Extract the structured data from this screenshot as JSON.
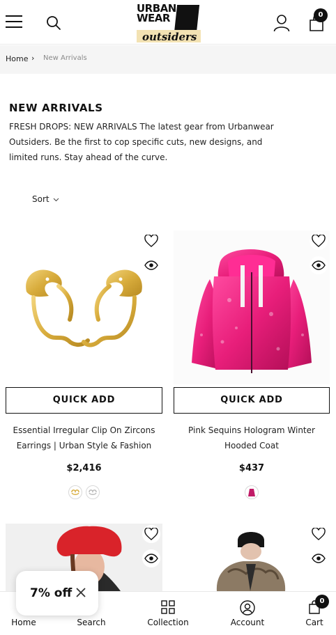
{
  "header": {
    "logo_text_top": "URBAN WEAR",
    "logo_text_bottom": "outsiders",
    "cart_count": "0"
  },
  "breadcrumb": {
    "home": "Home",
    "separator": "›",
    "current": "New Arrivals"
  },
  "collection": {
    "title": "NEW ARRIVALS",
    "description": "FRESH DROPS: NEW ARRIVALS The latest gear from Urbanwear Outsiders. Be the first to cop specific cuts, new designs, and limited runs. Stay ahead of the curve.",
    "sort_label": "Sort"
  },
  "products": [
    {
      "title": "Essential Irregular Clip On Zircons Earrings | Urban Style & Fashion",
      "price": "$2,416",
      "quick_add": "QUICK ADD",
      "swatches": [
        "gold",
        "silver"
      ]
    },
    {
      "title": "Pink Sequins Hologram Winter Hooded Coat",
      "price": "$437",
      "quick_add": "QUICK ADD",
      "swatches": [
        "pink"
      ]
    }
  ],
  "popup": {
    "discount_text": "7% off"
  },
  "bottom_nav": {
    "home": "Home",
    "search": "Search",
    "collection": "Collection",
    "account": "Account",
    "cart": "Cart",
    "cart_count": "0"
  },
  "colors": {
    "accent": "#111111",
    "sequin_pink": "#e81e7a",
    "gold": "#d8ac3c",
    "hat_red": "#d9232a"
  }
}
